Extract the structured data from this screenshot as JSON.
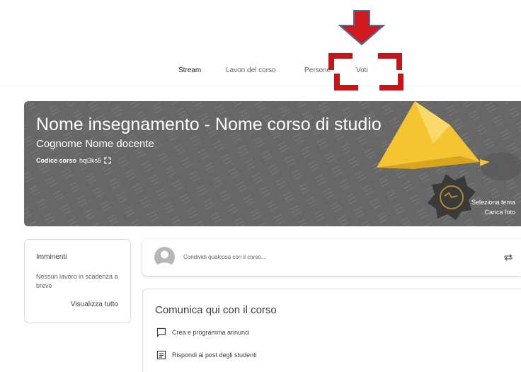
{
  "nav": {
    "tabs": [
      {
        "label": "Stream",
        "active": true
      },
      {
        "label": "Lavori del corso",
        "active": false
      },
      {
        "label": "Persone",
        "active": false
      },
      {
        "label": "Voti",
        "active": false
      }
    ]
  },
  "banner": {
    "course_title": "Nome insegnamento - Nome corso di studio",
    "teacher_name": "Cognome Nome docente",
    "code_label": "Codice corso",
    "code_value": "hqi3ks5",
    "select_theme": "Seleziona tema",
    "upload_photo": "Carica foto",
    "background_color": "#676767",
    "accent_color": "#f5c531"
  },
  "upcoming": {
    "title": "Imminenti",
    "empty_text": "Nessun lavoro in scadenza a breve",
    "view_all": "Visualizza tutto"
  },
  "share": {
    "placeholder": "Condividi qualcosa con il corso..."
  },
  "communicate": {
    "title": "Comunica qui con il corso",
    "items": [
      {
        "label": "Crea e programma annunci",
        "icon": "comment-icon"
      },
      {
        "label": "Rispondi ai post degli studenti",
        "icon": "post-icon"
      }
    ]
  },
  "annotation": {
    "color": "#c5131a",
    "arrow_fill": "#d11a20",
    "arrow_border": "#4a6fa5"
  }
}
